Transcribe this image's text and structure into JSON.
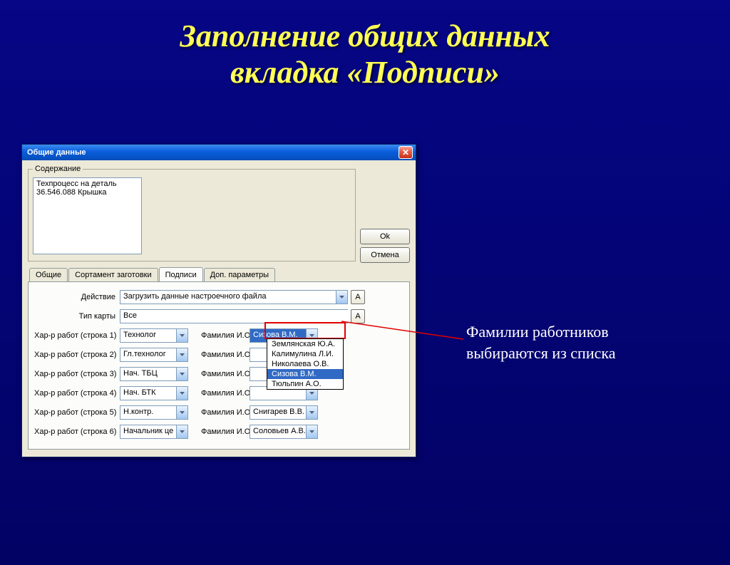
{
  "slide": {
    "title_line1": "Заполнение общих данных",
    "title_line2": "вкладка «Подписи»"
  },
  "dialog": {
    "title": "Общие данные",
    "close_x": "✕",
    "groupbox_label": "Содержание",
    "contents_text": "Техпроцесс на деталь 36.546.088 Крышка",
    "buttons": {
      "ok": "Ok",
      "cancel": "Отмена"
    },
    "tabs": [
      "Общие",
      "Сортамент заготовки",
      "Подписи",
      "Доп. параметры"
    ],
    "active_tab_index": 2,
    "form": {
      "action_label": "Действие",
      "action_value": "Загрузить данные настроечного файла",
      "cardtype_label": "Тип карты",
      "cardtype_value": "Все",
      "a_button": "А",
      "role_label_prefix": "Хар-р работ (строка ",
      "role_label_suffix": ")",
      "name_label": "Фамилия И.О.",
      "rows": [
        {
          "role": "Технолог",
          "name": "Сизова В.М."
        },
        {
          "role": "Гл.технолог",
          "name": ""
        },
        {
          "role": "Нач. ТБЦ",
          "name": ""
        },
        {
          "role": "Нач. БТК",
          "name": ""
        },
        {
          "role": "Н.контр.",
          "name": "Снигарев В.В."
        },
        {
          "role": "Начальник це",
          "name": "Соловьев А.В."
        }
      ],
      "dropdown_options": [
        "Землянская Ю.А.",
        "Калимулина Л.И.",
        "Николаева О.В.",
        "Сизова В.М.",
        "Тюльпин А.О."
      ],
      "dropdown_selected_index": 3
    }
  },
  "callout": {
    "line1": "Фамилии работников",
    "line2": "выбираются из списка"
  }
}
